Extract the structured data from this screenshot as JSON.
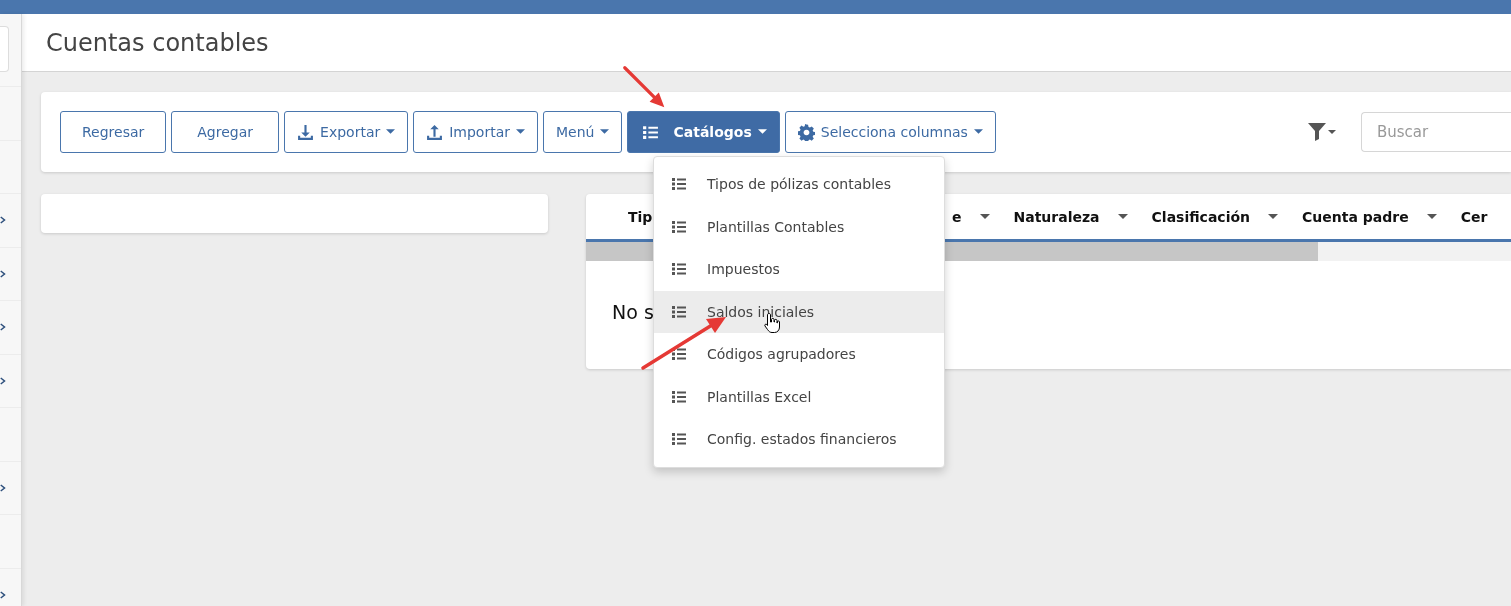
{
  "page": {
    "title": "Cuentas contables"
  },
  "sidebar": {
    "rows": [
      {
        "chevron": false
      },
      {
        "chevron": false
      },
      {
        "chevron": true
      },
      {
        "chevron": true
      },
      {
        "chevron": true
      },
      {
        "chevron": true
      },
      {
        "chevron": false
      },
      {
        "chevron": true
      },
      {
        "chevron": false
      },
      {
        "chevron": true
      }
    ]
  },
  "toolbar": {
    "buttons": [
      {
        "label": "Regresar",
        "kind": "plain",
        "caret": false,
        "selected": false
      },
      {
        "label": "Agregar",
        "kind": "plain",
        "caret": false,
        "selected": false
      },
      {
        "label": "Exportar",
        "kind": "download",
        "caret": true,
        "selected": false
      },
      {
        "label": "Importar",
        "kind": "upload",
        "caret": true,
        "selected": false
      },
      {
        "label": "Menú",
        "kind": "plain",
        "caret": true,
        "selected": false
      },
      {
        "label": "Catálogos",
        "kind": "list",
        "caret": true,
        "selected": true
      },
      {
        "label": "Selecciona columnas",
        "kind": "gear",
        "caret": true,
        "selected": false
      }
    ],
    "search": {
      "placeholder": "Buscar"
    }
  },
  "dropdown": {
    "items": [
      {
        "label": "Tipos de pólizas contables",
        "selected": false
      },
      {
        "label": "Plantillas Contables",
        "selected": false
      },
      {
        "label": "Impuestos",
        "selected": false
      },
      {
        "label": "Saldos iniciales",
        "selected": true
      },
      {
        "label": "Códigos agrupadores",
        "selected": false
      },
      {
        "label": "Plantillas Excel",
        "selected": false
      },
      {
        "label": "Config. estados financieros",
        "selected": false
      }
    ]
  },
  "table": {
    "columns": [
      {
        "label": "Tip"
      },
      {
        "label": "e",
        "caret": true
      },
      {
        "label": "Naturaleza",
        "caret": true
      },
      {
        "label": "Clasificación",
        "caret": true
      },
      {
        "label": "Cuenta padre",
        "caret": true
      },
      {
        "label": "Cer"
      }
    ],
    "empty_message": "No s"
  }
}
